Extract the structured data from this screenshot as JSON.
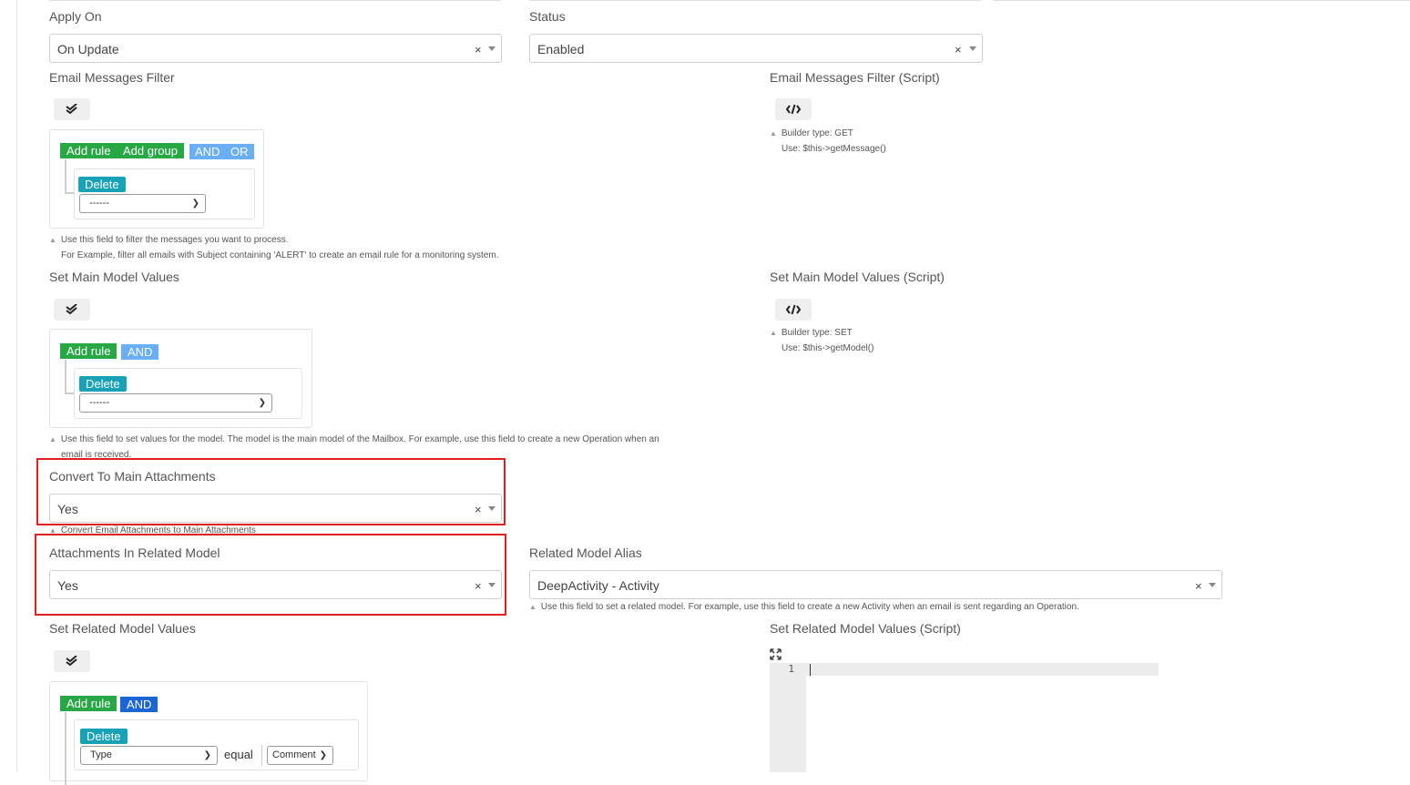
{
  "apply_on": {
    "label": "Apply On",
    "value": "On Update"
  },
  "status": {
    "label": "Status",
    "value": "Enabled"
  },
  "email_filter": {
    "label": "Email Messages Filter",
    "add_rule": "Add rule",
    "add_group": "Add group",
    "and": "AND",
    "or": "OR",
    "delete": "Delete",
    "select_value": "------",
    "help_line1": "Use this field to filter the messages you want to process.",
    "help_line2": "For Example, filter all emails with Subject containing 'ALERT' to create an email rule for a monitoring system."
  },
  "email_filter_script": {
    "label": "Email Messages Filter (Script)",
    "help_line1": "Builder type: GET",
    "help_line2": "Use: $this->getMessage()"
  },
  "main_model": {
    "label": "Set Main Model Values",
    "add_rule": "Add rule",
    "and": "AND",
    "delete": "Delete",
    "select_value": "------",
    "help_line1": "Use this field to set values for the model. The model is the main model of the Mailbox. For example, use this field to create a new Operation when an",
    "help_line2": "email is received."
  },
  "main_model_script": {
    "label": "Set Main Model Values (Script)",
    "help_line1": "Builder type: SET",
    "help_line2": "Use: $this->getModel()"
  },
  "convert_attachments": {
    "label": "Convert To Main Attachments",
    "value": "Yes",
    "help": "Convert Email Attachments to Main Attachments"
  },
  "attachments_related": {
    "label": "Attachments In Related Model",
    "value": "Yes"
  },
  "related_alias": {
    "label": "Related Model Alias",
    "value": "DeepActivity - Activity",
    "help": "Use this field to set a related model. For example, use this field to create a new Activity when an email is sent regarding an Operation."
  },
  "related_values": {
    "label": "Set Related Model Values",
    "add_rule": "Add rule",
    "and": "AND",
    "delete": "Delete",
    "field_value": "Type",
    "operator": "equal",
    "operand_value": "Comment"
  },
  "related_script": {
    "label": "Set Related Model Values (Script)",
    "line_number": "1"
  },
  "icons": {
    "clear": "×",
    "builder": "double-check-icon",
    "code": "code-icon",
    "expand": "expand-icon",
    "help": "▲"
  },
  "colors": {
    "green": "#28a745",
    "light_blue": "#6aaef7",
    "dark_blue": "#1a66d6",
    "teal": "#17a2b8",
    "highlight": "#e02020"
  }
}
